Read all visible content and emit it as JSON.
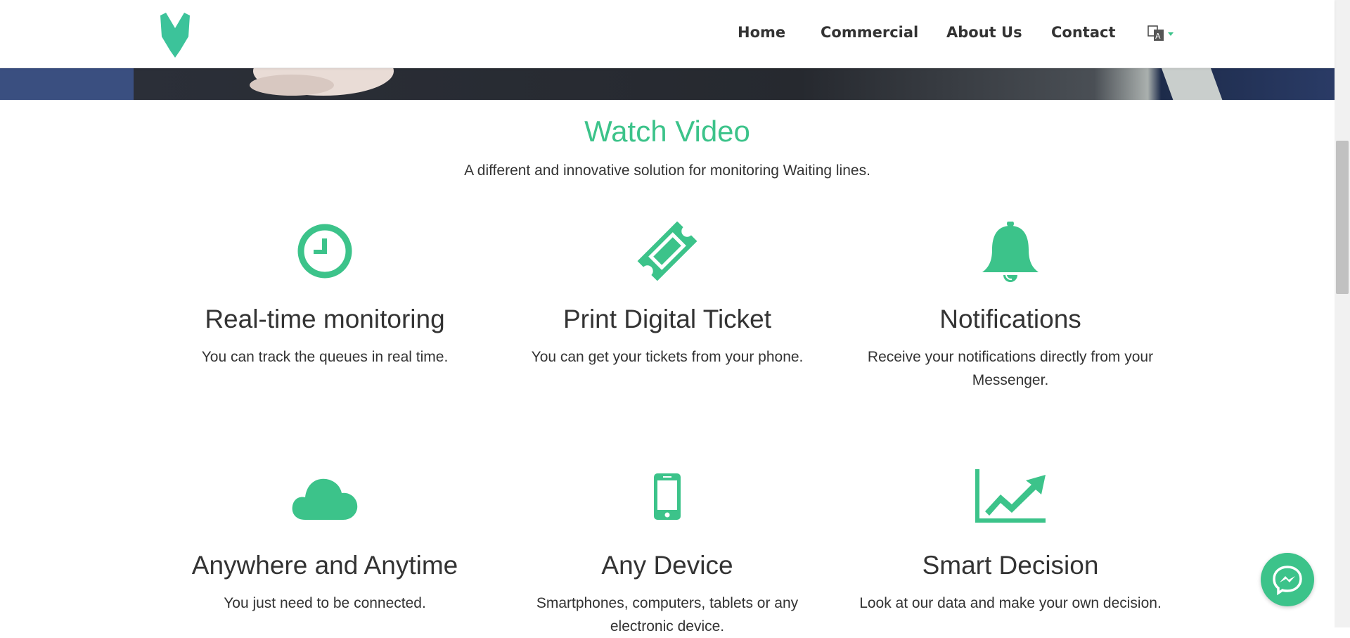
{
  "nav": {
    "items": [
      "Home",
      "Commercial",
      "About Us",
      "Contact"
    ],
    "language_icon": "translate-icon"
  },
  "section": {
    "title": "Watch Video",
    "subtitle": "A different and innovative solution for monitoring Waiting lines."
  },
  "features": [
    {
      "icon": "clock-icon",
      "title": "Real-time monitoring",
      "text": "You can track the queues in real time."
    },
    {
      "icon": "ticket-icon",
      "title": "Print Digital Ticket",
      "text": "You can get your tickets from your phone."
    },
    {
      "icon": "bell-icon",
      "title": "Notifications",
      "text": "Receive your notifications directly from your Messenger."
    },
    {
      "icon": "cloud-icon",
      "title": "Anywhere and Anytime",
      "text": "You just need to be connected."
    },
    {
      "icon": "mobile-icon",
      "title": "Any Device",
      "text": "Smartphones, computers, tablets or any electronic device."
    },
    {
      "icon": "chart-line-icon",
      "title": "Smart Decision",
      "text": "Look at our data and make your own decision."
    }
  ],
  "colors": {
    "accent": "#3cc38a",
    "text": "#333333"
  },
  "messenger_icon": "messenger-icon"
}
